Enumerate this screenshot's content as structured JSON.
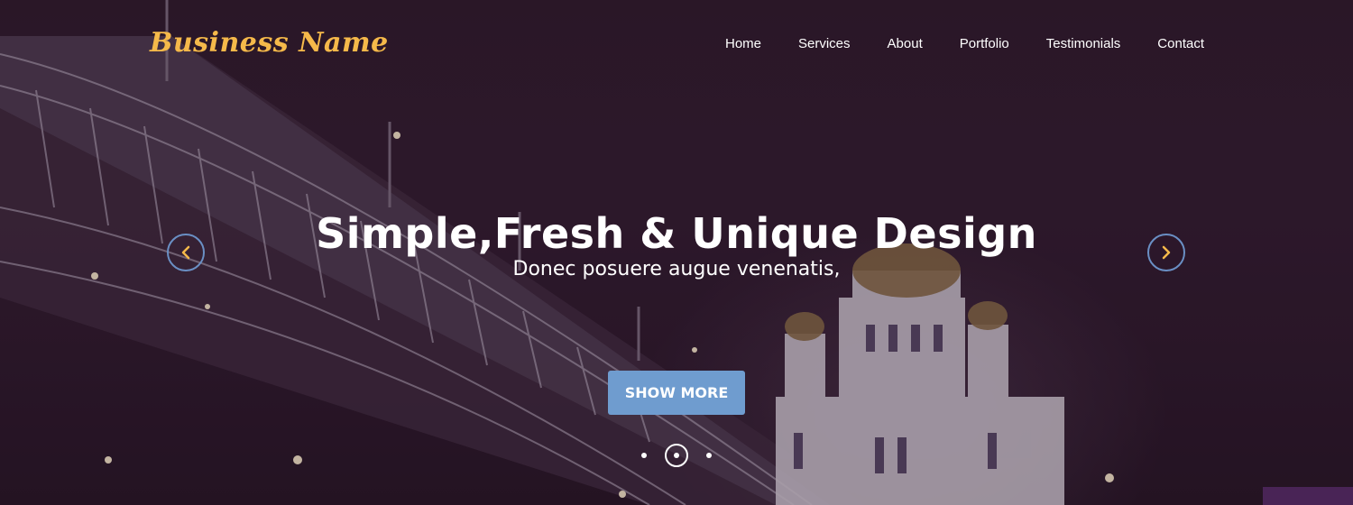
{
  "brand": {
    "name": "Business Name"
  },
  "nav": {
    "items": [
      "Home",
      "Services",
      "About",
      "Portfolio",
      "Testimonials",
      "Contact"
    ]
  },
  "hero": {
    "headline": "Simple,Fresh & Unique Design",
    "subheadline": "Donec posuere augue venenatis,",
    "cta_label": "SHOW MORE",
    "slide_count": 3,
    "active_slide": 2
  },
  "colors": {
    "brand": "#f5b94a",
    "cta": "#6f9ccf",
    "arrow_ring": "#6a8fc4",
    "arrow_chevron": "#f5b94a"
  },
  "icons": {
    "prev": "chevron-left-icon",
    "next": "chevron-right-icon"
  }
}
